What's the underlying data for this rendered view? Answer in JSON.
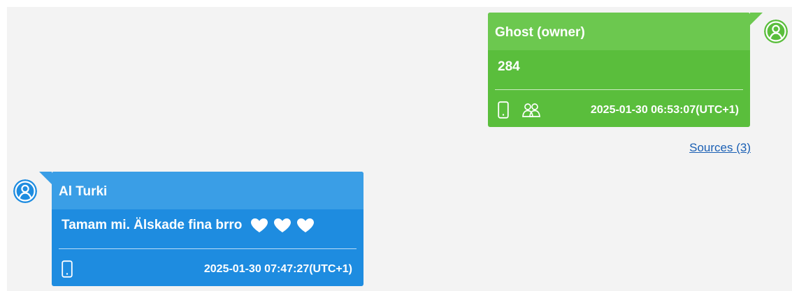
{
  "colors": {
    "background": "#f3f3f3",
    "owner_bubble": "#5abe3c",
    "owner_header": "#6cc84f",
    "contact_bubble": "#1e8ce0",
    "contact_header": "#3a9ee6",
    "link": "#1a5fb4"
  },
  "messages": [
    {
      "direction": "outgoing",
      "sender": "Ghost (owner)",
      "body": "284",
      "icons": [
        "phone-icon",
        "group-icon"
      ],
      "timestamp": "2025-01-30 06:53:07(UTC+1)",
      "sources_link": "Sources (3)"
    },
    {
      "direction": "incoming",
      "sender": "Al Turki",
      "body": "Tamam mi. Älskade fina brro",
      "emoji": [
        "white-heart",
        "white-heart",
        "white-heart"
      ],
      "icons": [
        "phone-icon"
      ],
      "timestamp": "2025-01-30 07:47:27(UTC+1)"
    }
  ]
}
